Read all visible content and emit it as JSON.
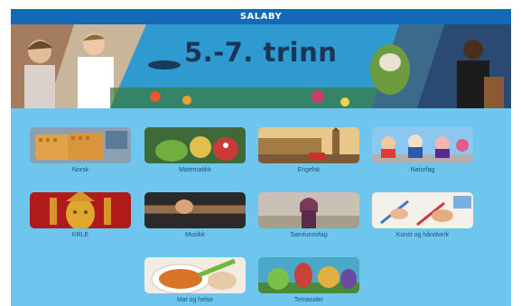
{
  "header": {
    "title": "SALABY"
  },
  "banner": {
    "title": "5.-7. trinn"
  },
  "subjects": [
    {
      "label": "Norsk",
      "icon": "waffles-image"
    },
    {
      "label": "Matematikk",
      "icon": "creatures-image"
    },
    {
      "label": "Engelsk",
      "icon": "london-image"
    },
    {
      "label": "Naturfag",
      "icon": "cartoon-characters-image"
    },
    {
      "label": "KRLE",
      "icon": "buddha-image"
    },
    {
      "label": "Musikk",
      "icon": "guitar-image"
    },
    {
      "label": "Samfunnsfag",
      "icon": "refugee-image"
    },
    {
      "label": "Kunst og håndverk",
      "icon": "painting-hands-image"
    },
    {
      "label": "Mat og helse",
      "icon": "cooking-image"
    },
    {
      "label": "Temasider",
      "icon": "fantasy-creatures-image"
    }
  ],
  "colors": {
    "topbar": "#1368b8",
    "background": "#6ec6ee",
    "label": "#1f4f74",
    "banner_title": "#1a3556"
  }
}
